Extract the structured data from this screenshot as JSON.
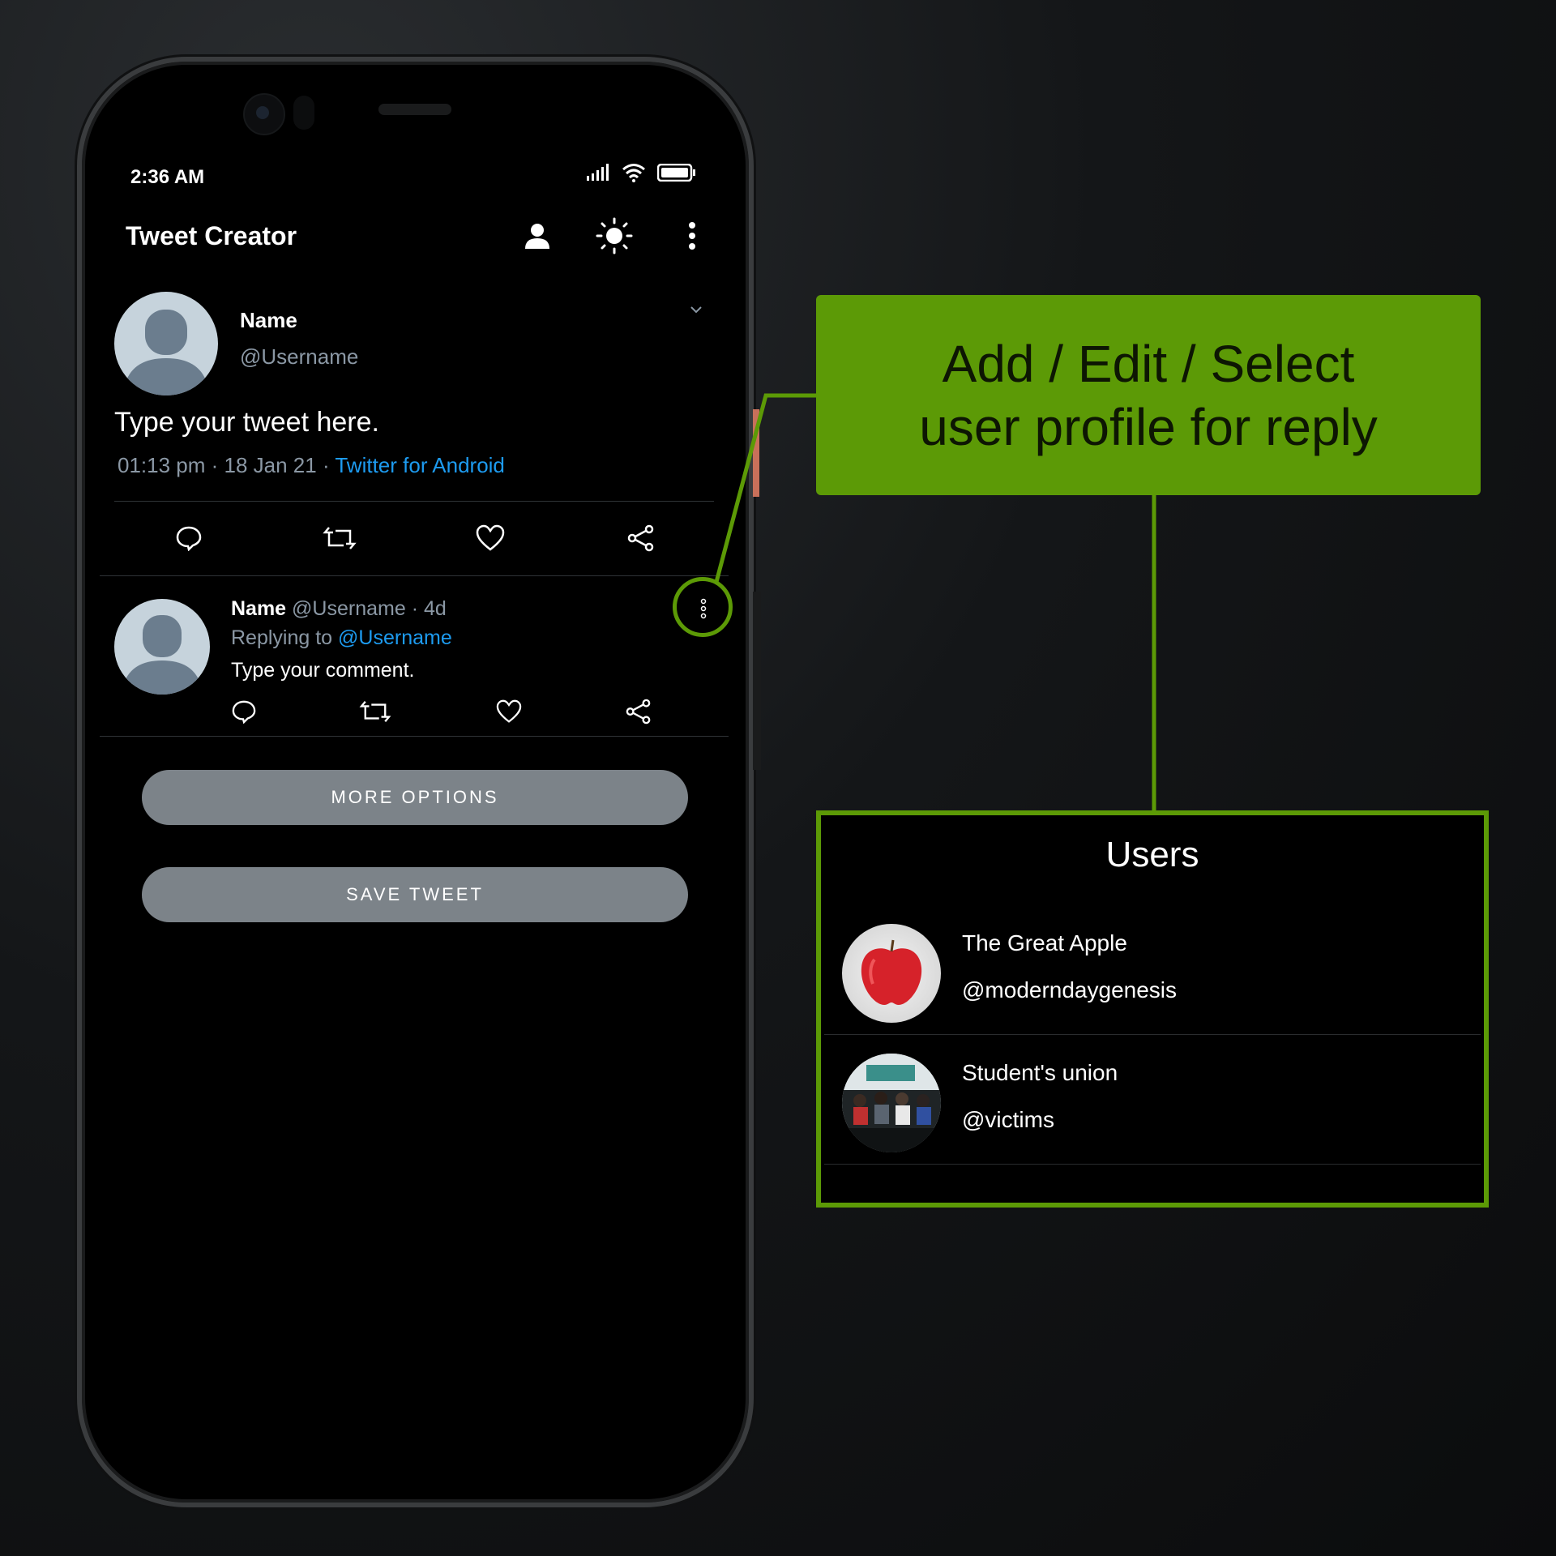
{
  "status": {
    "time": "2:36 AM"
  },
  "appbar": {
    "title": "Tweet Creator",
    "icons": [
      "person-icon",
      "brightness-icon",
      "more-vert-icon"
    ]
  },
  "tweet": {
    "name": "Name",
    "username": "@Username",
    "text": "Type your tweet here.",
    "meta_time": "01:13 pm · 18 Jan 21 · ",
    "meta_source": "Twitter for Android"
  },
  "reply": {
    "name": "Name",
    "username_time": "@Username · 4d",
    "replying_prefix": "Replying to ",
    "replying_user": "@Username",
    "text": "Type your comment."
  },
  "buttons": {
    "more_options": "MORE OPTIONS",
    "save_tweet": "SAVE TWEET"
  },
  "callout": {
    "line1": "Add / Edit / Select",
    "line2": "user profile for reply"
  },
  "users_panel": {
    "title": "Users",
    "users": [
      {
        "name": "The Great Apple",
        "handle": "@moderndaygenesis"
      },
      {
        "name": "Student's union",
        "handle": "@victims"
      }
    ]
  },
  "colors": {
    "accent_green": "#5c9a06",
    "link_blue": "#1d9bf0",
    "muted": "#8b98a5",
    "button_gray": "#7c8389"
  }
}
